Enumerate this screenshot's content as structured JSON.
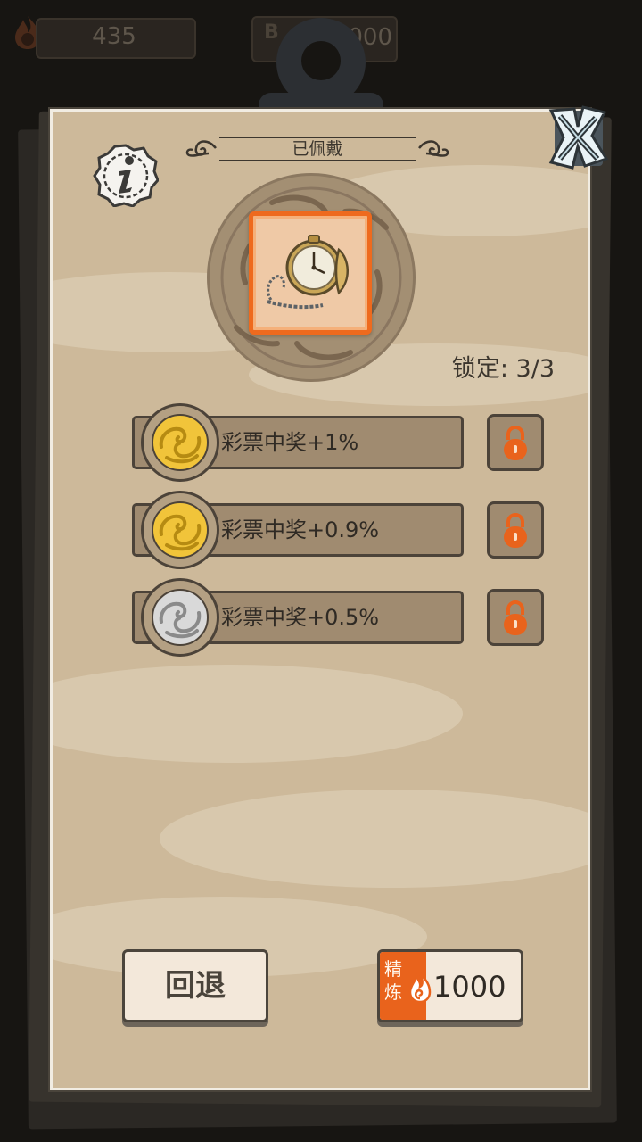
{
  "hud": {
    "resource_value": "435",
    "badge_letter": "B",
    "coin_value": "1000"
  },
  "panel": {
    "title": "已佩戴",
    "lock_count": "锁定: 3/3"
  },
  "stats": [
    {
      "label": "彩票中奖+1%",
      "orb": "gold",
      "locked": true
    },
    {
      "label": "彩票中奖+0.9%",
      "orb": "gold",
      "locked": true
    },
    {
      "label": "彩票中奖+0.5%",
      "orb": "silver",
      "locked": true
    }
  ],
  "buttons": {
    "back_label": "回退",
    "refine_label": "精炼",
    "refine_cost": "1000"
  },
  "colors": {
    "panel_bg": "#cdb99a",
    "accent_orange": "#e9631c",
    "dark_outline": "#4c4339"
  }
}
